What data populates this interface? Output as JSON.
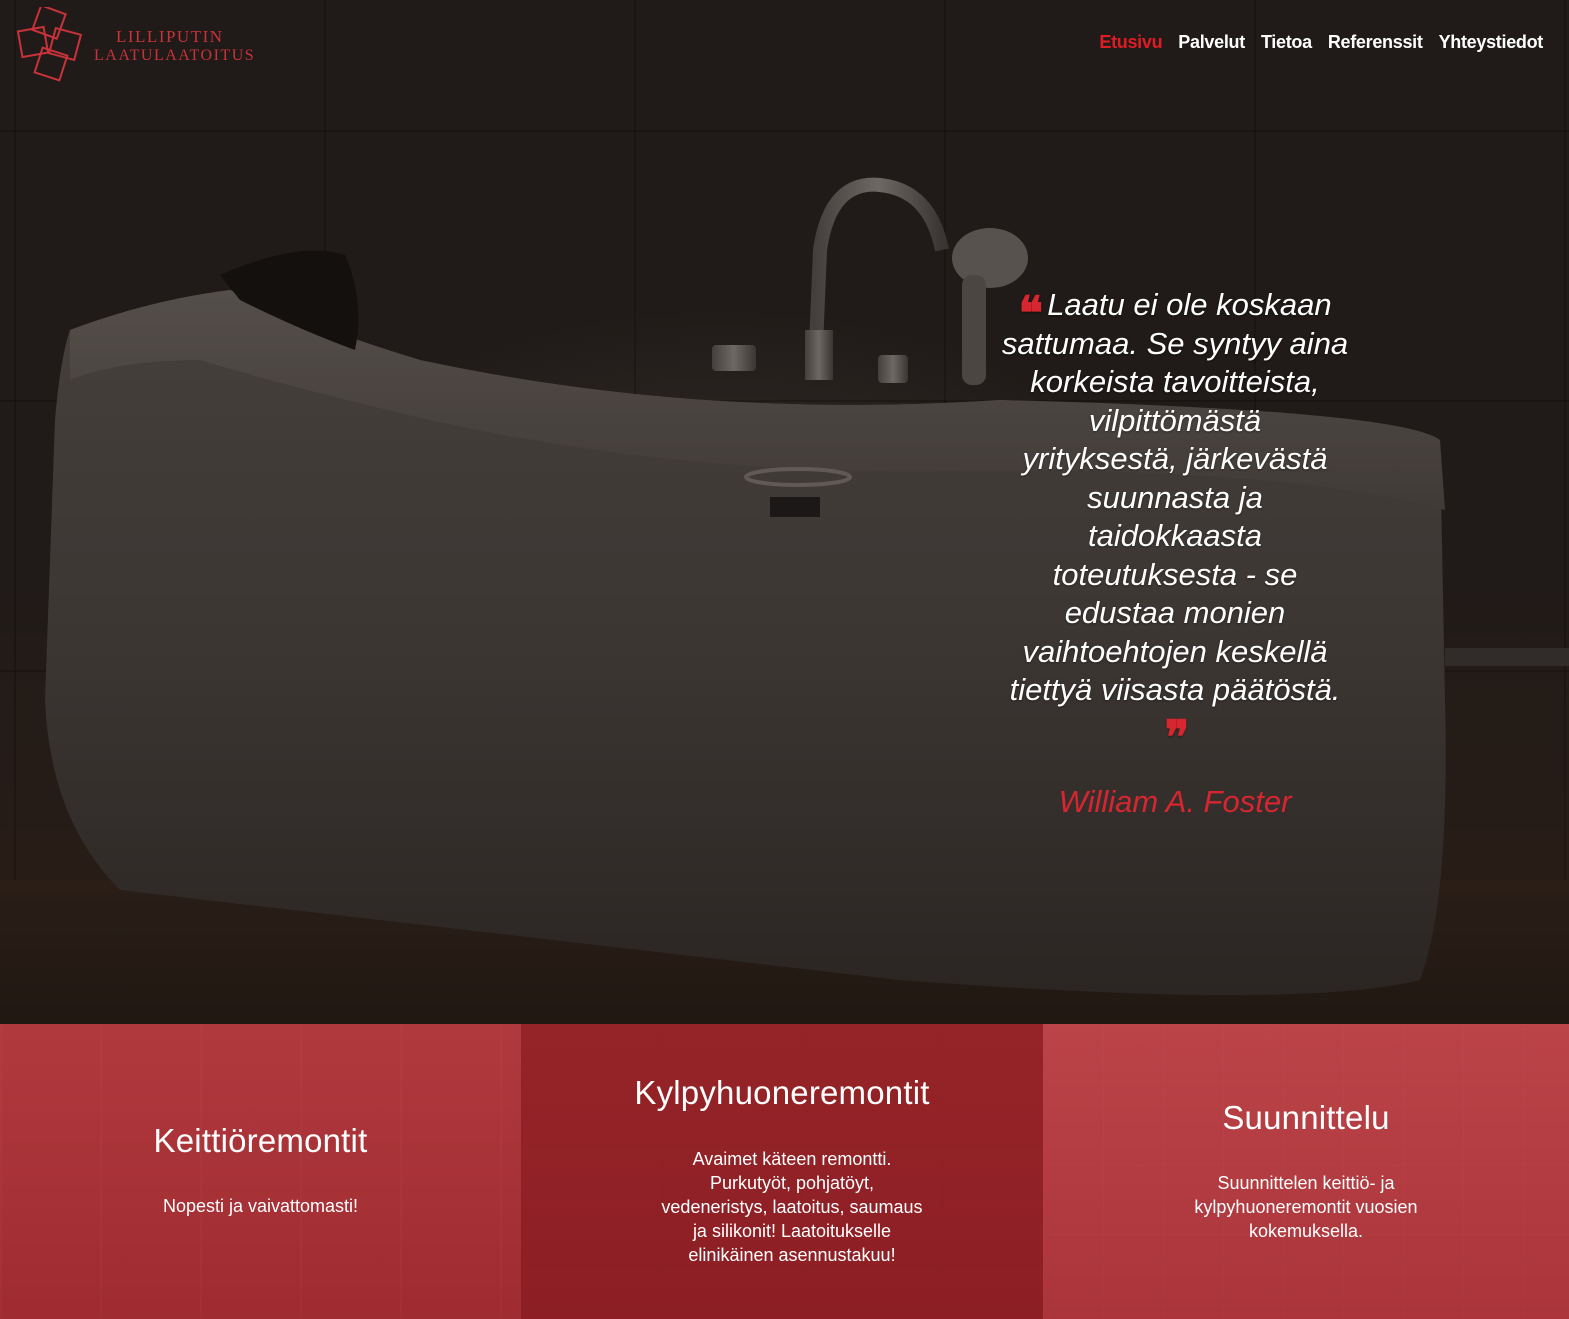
{
  "logo": {
    "line1": "LILLIPUTIN",
    "line2": "LAATULAATOITUS",
    "color": "#c8323a"
  },
  "nav": {
    "items": [
      {
        "label": "Etusivu",
        "active": true
      },
      {
        "label": "Palvelut",
        "active": false
      },
      {
        "label": "Tietoa",
        "active": false
      },
      {
        "label": "Referenssit",
        "active": false
      },
      {
        "label": "Yhteystiedot",
        "active": false
      }
    ],
    "active_color": "#e01b24"
  },
  "hero": {
    "quote_open": "❝",
    "quote_lines": [
      "Laatu ei ole koskaan",
      "sattumaa. Se syntyy aina",
      "korkeista tavoitteista,",
      "vilpittömästä",
      "yrityksestä, järkevästä",
      "suunnasta ja",
      "taidokkaasta",
      "toteutuksesta - se",
      "edustaa monien",
      "vaihtoehtojen keskellä",
      "tiettyä viisasta päätöstä."
    ],
    "quote_close": "❞",
    "author": "William A. Foster",
    "accent_color": "#d7262f"
  },
  "services": [
    {
      "title": "Keittiöremontit",
      "text": "Nopesti ja vaivattomasti!"
    },
    {
      "title": "Kylpyhuoneremontit",
      "text_lines": [
        "Avaimet käteen remontti.",
        "Purkutyöt, pohjatöyt,",
        "vedeneristys, laatoitus, saumaus",
        "ja silikonit! Laatoitukselle",
        "elinikäinen asennustakuu!"
      ]
    },
    {
      "title": "Suunnittelu",
      "text_lines": [
        "Suunnittelen keittiö- ja",
        "kylpyhuoneremontit vuosien",
        "kokemuksella."
      ]
    }
  ]
}
